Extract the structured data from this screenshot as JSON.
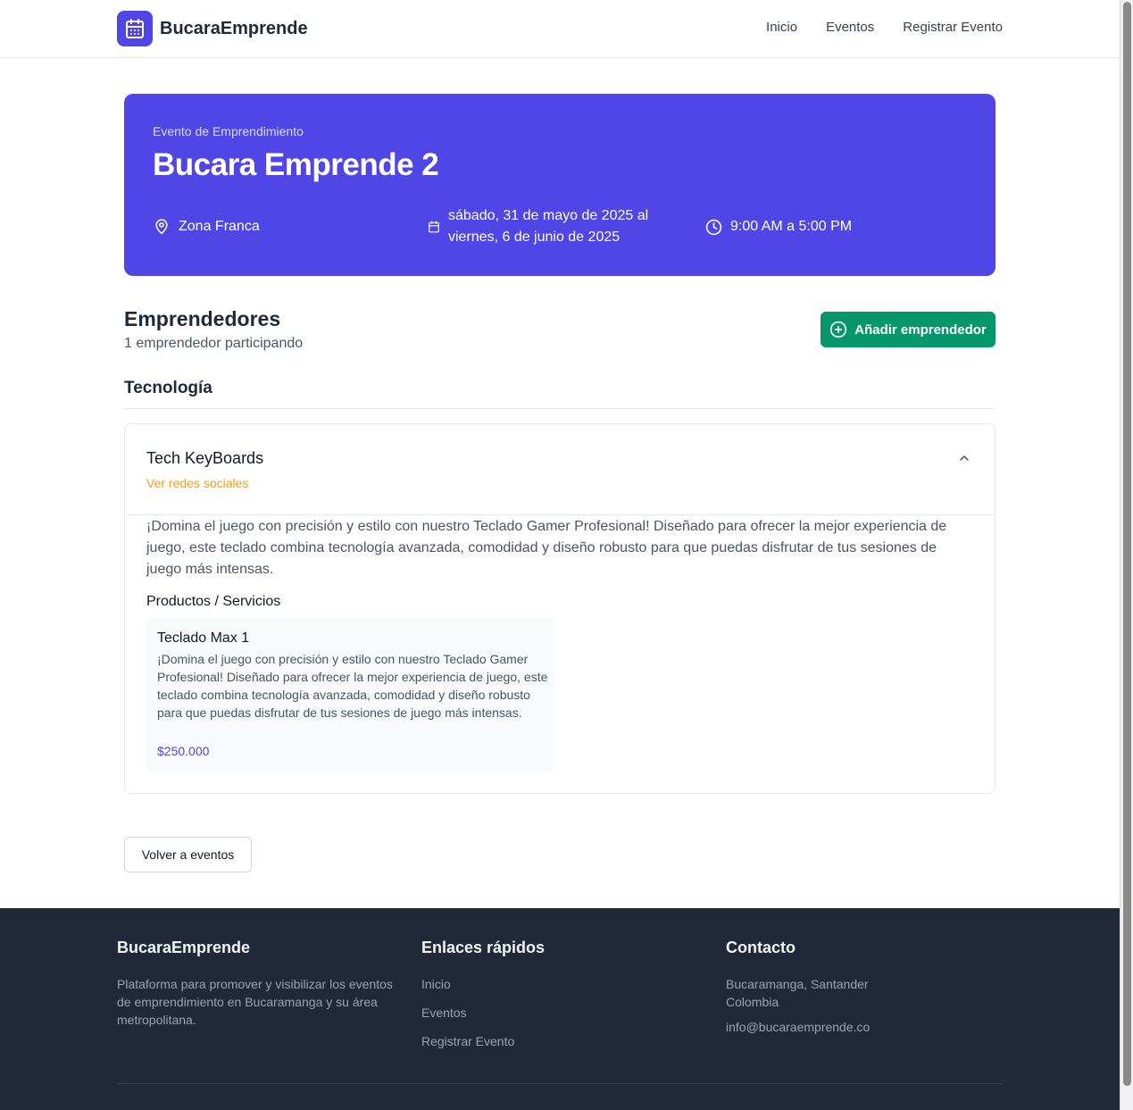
{
  "header": {
    "brand": "BucaraEmprende",
    "nav": [
      "Inicio",
      "Eventos",
      "Registrar Evento"
    ]
  },
  "event": {
    "eyebrow": "Evento de Emprendimiento",
    "title": "Bucara Emprende 2",
    "location": "Zona Franca",
    "date_line1": "sábado, 31 de mayo de 2025 al",
    "date_line2": "viernes, 6 de junio de 2025",
    "time": "9:00 AM a 5:00 PM"
  },
  "entrepreneurs": {
    "title": "Emprendedores",
    "count_text": "1 emprendedor participando",
    "add_button": "Añadir emprendedor",
    "category": "Tecnología",
    "items": [
      {
        "name": "Tech KeyBoards",
        "social_link": "Ver redes sociales",
        "description": "¡Domina el juego con precisión y estilo con nuestro Teclado Gamer Profesional! Diseñado para ofrecer la mejor experiencia de juego, este teclado combina tecnología avanzada, comodidad y diseño robusto para que puedas disfrutar de tus sesiones de juego más intensas.",
        "products_title": "Productos / Servicios",
        "products": [
          {
            "name": "Teclado Max 1",
            "description": "¡Domina el juego con precisión y estilo con nuestro Teclado Gamer Profesional! Diseñado para ofrecer la mejor experiencia de juego, este teclado combina tecnología avanzada, comodidad y diseño robusto para que puedas disfrutar de tus sesiones de juego más intensas.",
            "price": "$250.000"
          }
        ]
      }
    ]
  },
  "back_button": "Volver a eventos",
  "footer": {
    "brand": "BucaraEmprende",
    "about": "Plataforma para promover y visibilizar los eventos de emprendimiento en Bucaramanga y su área metropolitana.",
    "links_title": "Enlaces rápidos",
    "links": [
      "Inicio",
      "Eventos",
      "Registrar Evento"
    ],
    "contact_title": "Contacto",
    "contact_city": "Bucaramanga, Santander",
    "contact_country": "Colombia",
    "contact_email": "info@bucaraemprende.co"
  },
  "colors": {
    "primary": "#4f46e5",
    "success": "#059669",
    "accent": "#f59e0b",
    "footer_bg": "#1f2937"
  }
}
